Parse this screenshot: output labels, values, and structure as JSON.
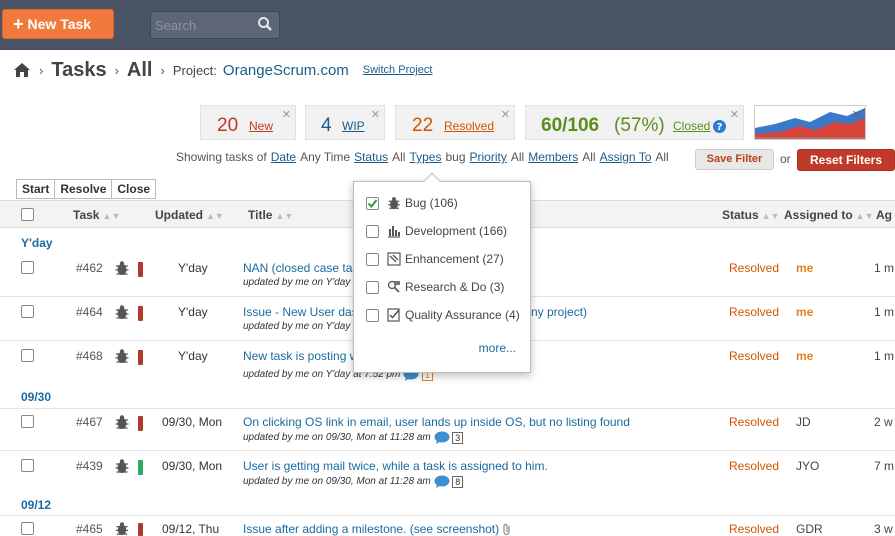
{
  "topbar": {
    "new_task_label": "New Task",
    "search_placeholder": "Search"
  },
  "breadcrumb": {
    "tasks": "Tasks",
    "all": "All",
    "project_label": "Project:",
    "project": "OrangeScrum.com",
    "switch": "Switch Project"
  },
  "stats": {
    "new": {
      "count": "20",
      "label": "New",
      "color": "#c0392b"
    },
    "wip": {
      "count": "4",
      "label": "WIP",
      "color": "#1a5d8a"
    },
    "resolved": {
      "count": "22",
      "label": "Resolved",
      "color": "#d35400"
    },
    "closed": {
      "count": "60/106",
      "percent": "(57%)",
      "label": "Closed",
      "color": "#5a8f1c"
    }
  },
  "filters": {
    "showing": "Showing tasks of",
    "date": "Date",
    "date_val": "Any Time",
    "status": "Status",
    "status_val": "All",
    "types": "Types",
    "types_val": "bug",
    "priority": "Priority",
    "priority_val": "All",
    "members": "Members",
    "members_val": "All",
    "assign": "Assign To",
    "assign_val": "All",
    "save": "Save Filter",
    "or": "or",
    "reset": "Reset Filters"
  },
  "actions": [
    "Start",
    "Resolve",
    "Close"
  ],
  "columns": {
    "task": "Task",
    "updated": "Updated",
    "title": "Title",
    "status": "Status",
    "assigned": "Assigned to",
    "age": "Ag"
  },
  "groups": [
    "Y'day",
    "09/30",
    "09/12"
  ],
  "rows": [
    {
      "id": "#462",
      "priority": "high",
      "updated": "Y'day",
      "title": "NAN (closed case tab",
      "meta": "updated by me on Y'day a",
      "status": "Resolved",
      "assigned": "me",
      "age": "1 m"
    },
    {
      "id": "#464",
      "priority": "high",
      "updated": "Y'day",
      "title": "Issue - New User das",
      "title_tail": "ny project)",
      "meta": "updated by me on Y'day a",
      "status": "Resolved",
      "assigned": "me",
      "age": "1 m"
    },
    {
      "id": "#468",
      "priority": "high",
      "updated": "Y'day",
      "title": "New task is posting w",
      "meta": "updated by me on Y'day at 7:52 pm",
      "comments": "1",
      "status": "Resolved",
      "assigned": "me",
      "age": "1 m"
    },
    {
      "id": "#467",
      "priority": "high",
      "updated": "09/30, Mon",
      "title": "On clicking OS link in email, user lands up inside OS, but no listing found",
      "meta": "updated by me on 09/30, Mon at 11:28 am",
      "comments": "3",
      "status": "Resolved",
      "assigned": "JD",
      "age": "2 w"
    },
    {
      "id": "#439",
      "priority": "low",
      "updated": "09/30, Mon",
      "title": "User is getting mail twice, while a task is assigned to him.",
      "meta": "updated by me on 09/30, Mon at 11:28 am",
      "comments": "8",
      "status": "Resolved",
      "assigned": "JYO",
      "age": "7 m"
    },
    {
      "id": "#465",
      "priority": "high",
      "updated": "09/12, Thu",
      "title": "Issue after adding a milestone. (see screenshot)",
      "status": "Resolved",
      "assigned": "GDR",
      "age": "3 w"
    }
  ],
  "type_dropdown": {
    "items": [
      {
        "label": "Bug (106)",
        "checked": true,
        "icon": "bug-icon"
      },
      {
        "label": "Development (166)",
        "checked": false,
        "icon": "development-icon"
      },
      {
        "label": "Enhancement (27)",
        "checked": false,
        "icon": "enhancement-icon"
      },
      {
        "label": "Research & Do (3)",
        "checked": false,
        "icon": "research-icon"
      },
      {
        "label": "Quality Assurance (4)",
        "checked": false,
        "icon": "qa-icon"
      }
    ],
    "more": "more..."
  },
  "colors": {
    "topbar": "#495467",
    "accent_orange": "#f07a3c",
    "link_blue": "#1a6aa0",
    "priority_high": "#b03a2e",
    "priority_low": "#27ae60"
  }
}
